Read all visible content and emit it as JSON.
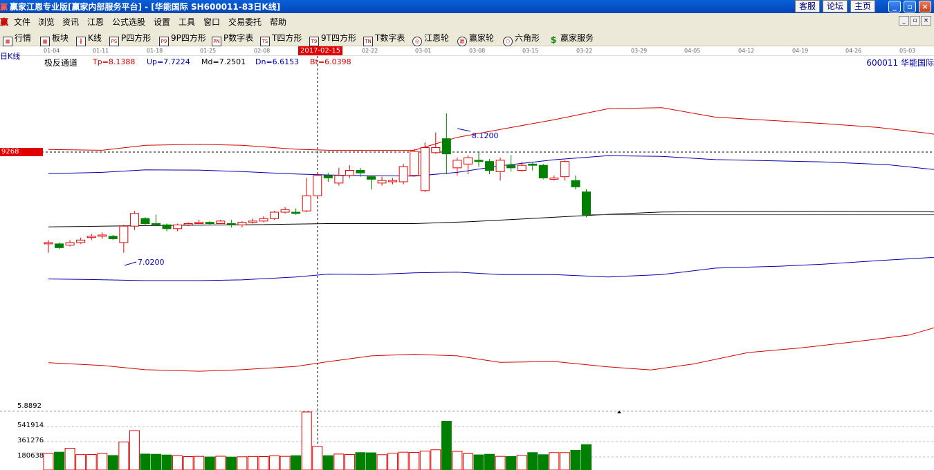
{
  "window": {
    "logo": "赢",
    "title": "赢家江恩专业版[赢家内部服务平台] - [华能国际   SH600011-83日K线]",
    "buttons": [
      "客服",
      "论坛",
      "主页"
    ],
    "controls": [
      "_",
      "▫",
      "×"
    ]
  },
  "menu": {
    "logo": "赢",
    "items": [
      "文件",
      "浏览",
      "资讯",
      "江恩",
      "公式选股",
      "设置",
      "工具",
      "窗口",
      "交易委托",
      "帮助"
    ],
    "mdi_controls": [
      "_",
      "▫",
      "×"
    ]
  },
  "toolbar": {
    "items": [
      {
        "label": "行情",
        "icon": "grid-icon",
        "glyph": "▦"
      },
      {
        "label": "板块",
        "icon": "blocks-icon",
        "glyph": "▩"
      },
      {
        "label": "K线",
        "icon": "candlestick-icon",
        "glyph": "╫"
      },
      {
        "label": "P四方形",
        "icon": "p-square-icon",
        "glyph": "PS"
      },
      {
        "label": "9P四方形",
        "icon": "9p-square-icon",
        "glyph": "P9"
      },
      {
        "label": "P数字表",
        "icon": "p-number-table-icon",
        "glyph": "PN"
      },
      {
        "label": "T四方形",
        "icon": "t-square-icon",
        "glyph": "TS"
      },
      {
        "label": "9T四方形",
        "icon": "9t-square-icon",
        "glyph": "T9"
      },
      {
        "label": "T数字表",
        "icon": "t-number-table-icon",
        "glyph": "TN"
      },
      {
        "label": "江恩轮",
        "icon": "gann-wheel-icon",
        "glyph": "◎"
      },
      {
        "label": "赢家轮",
        "icon": "winner-wheel-icon",
        "glyph": "赢"
      },
      {
        "label": "六角形",
        "icon": "hexagon-icon",
        "glyph": "⬡"
      },
      {
        "label": "赢家服务",
        "icon": "dollar-icon",
        "glyph": "$"
      }
    ]
  },
  "date_axis": {
    "labels": [
      "01-04",
      "01-11",
      "01-18",
      "01-25",
      "02-08",
      "02-22",
      "03-01",
      "03-08",
      "03-15",
      "03-22",
      "03-29",
      "04-05",
      "04-12",
      "04-19",
      "04-26",
      "05-03"
    ],
    "highlight": "2017-02-15"
  },
  "indicator": {
    "period_label": "日K线",
    "name": "极反通道",
    "tp": "Tp=8.1388",
    "up": "Up=7.7224",
    "md": "Md=7.2501",
    "dn": "Dn=6.6153",
    "bt": "Bt=6.0398",
    "stock": "600011 华能国际",
    "price_marker": "9268",
    "high_label": "8.1200",
    "low_label": "7.0200"
  },
  "volume": {
    "labels": [
      "5.8892",
      "541914",
      "361276",
      "180638"
    ]
  },
  "colors": {
    "titlebar": "#0453c4",
    "up_candle": "#e00000",
    "down_candle": "#008000",
    "tp_bt_line": "#d00000",
    "up_dn_line": "#0000b0",
    "md_line": "#000000"
  },
  "chart_data": {
    "type": "candlestick",
    "y_range": [
      5.84,
      8.48
    ],
    "candles": [
      {
        "o": 7.09,
        "c": 7.1,
        "h": 7.12,
        "l": 7.02
      },
      {
        "o": 7.09,
        "c": 7.06,
        "h": 7.1,
        "l": 7.05
      },
      {
        "o": 7.08,
        "c": 7.1,
        "h": 7.12,
        "l": 7.07
      },
      {
        "o": 7.1,
        "c": 7.12,
        "h": 7.14,
        "l": 7.09
      },
      {
        "o": 7.14,
        "c": 7.15,
        "h": 7.17,
        "l": 7.12
      },
      {
        "o": 7.15,
        "c": 7.16,
        "h": 7.18,
        "l": 7.13
      },
      {
        "o": 7.15,
        "c": 7.13,
        "h": 7.16,
        "l": 7.12
      },
      {
        "o": 7.1,
        "c": 7.23,
        "h": 7.24,
        "l": 7.02
      },
      {
        "o": 7.23,
        "c": 7.33,
        "h": 7.35,
        "l": 7.2
      },
      {
        "o": 7.29,
        "c": 7.25,
        "h": 7.3,
        "l": 7.24
      },
      {
        "o": 7.25,
        "c": 7.24,
        "h": 7.32,
        "l": 7.23
      },
      {
        "o": 7.24,
        "c": 7.21,
        "h": 7.25,
        "l": 7.19
      },
      {
        "o": 7.21,
        "c": 7.24,
        "h": 7.25,
        "l": 7.19
      },
      {
        "o": 7.24,
        "c": 7.25,
        "h": 7.26,
        "l": 7.23
      },
      {
        "o": 7.25,
        "c": 7.26,
        "h": 7.28,
        "l": 7.25
      },
      {
        "o": 7.26,
        "c": 7.25,
        "h": 7.27,
        "l": 7.24
      },
      {
        "o": 7.25,
        "c": 7.27,
        "h": 7.28,
        "l": 7.25
      },
      {
        "o": 7.25,
        "c": 7.24,
        "h": 7.28,
        "l": 7.22
      },
      {
        "o": 7.24,
        "c": 7.26,
        "h": 7.27,
        "l": 7.22
      },
      {
        "o": 7.26,
        "c": 7.27,
        "h": 7.29,
        "l": 7.25
      },
      {
        "o": 7.27,
        "c": 7.29,
        "h": 7.31,
        "l": 7.26
      },
      {
        "o": 7.29,
        "c": 7.34,
        "h": 7.35,
        "l": 7.28
      },
      {
        "o": 7.34,
        "c": 7.36,
        "h": 7.38,
        "l": 7.33
      },
      {
        "o": 7.34,
        "c": 7.33,
        "h": 7.37,
        "l": 7.32
      },
      {
        "o": 7.35,
        "c": 7.47,
        "h": 7.61,
        "l": 7.34
      },
      {
        "o": 7.47,
        "c": 7.63,
        "h": 7.65,
        "l": 7.45
      },
      {
        "o": 7.63,
        "c": 7.61,
        "h": 7.65,
        "l": 7.58
      },
      {
        "o": 7.57,
        "c": 7.63,
        "h": 7.69,
        "l": 7.55
      },
      {
        "o": 7.63,
        "c": 7.67,
        "h": 7.71,
        "l": 7.61
      },
      {
        "o": 7.67,
        "c": 7.65,
        "h": 7.69,
        "l": 7.62
      },
      {
        "o": 7.62,
        "c": 7.6,
        "h": 7.63,
        "l": 7.52
      },
      {
        "o": 7.57,
        "c": 7.59,
        "h": 7.62,
        "l": 7.55
      },
      {
        "o": 7.58,
        "c": 7.59,
        "h": 7.61,
        "l": 7.56
      },
      {
        "o": 7.58,
        "c": 7.7,
        "h": 7.72,
        "l": 7.56
      },
      {
        "o": 7.63,
        "c": 7.82,
        "h": 7.84,
        "l": 7.62
      },
      {
        "o": 7.51,
        "c": 7.85,
        "h": 7.89,
        "l": 7.5
      },
      {
        "o": 7.81,
        "c": 7.85,
        "h": 7.97,
        "l": 7.8
      },
      {
        "o": 7.92,
        "c": 7.8,
        "h": 8.12,
        "l": 7.64
      },
      {
        "o": 7.69,
        "c": 7.75,
        "h": 7.77,
        "l": 7.63
      },
      {
        "o": 7.72,
        "c": 7.77,
        "h": 7.79,
        "l": 7.64
      },
      {
        "o": 7.75,
        "c": 7.74,
        "h": 7.82,
        "l": 7.7
      },
      {
        "o": 7.74,
        "c": 7.67,
        "h": 7.76,
        "l": 7.64
      },
      {
        "o": 7.66,
        "c": 7.75,
        "h": 7.77,
        "l": 7.59
      },
      {
        "o": 7.71,
        "c": 7.69,
        "h": 7.79,
        "l": 7.66
      },
      {
        "o": 7.67,
        "c": 7.71,
        "h": 7.74,
        "l": 7.66
      },
      {
        "o": 7.72,
        "c": 7.71,
        "h": 7.73,
        "l": 7.67
      },
      {
        "o": 7.71,
        "c": 7.61,
        "h": 7.72,
        "l": 7.6
      },
      {
        "o": 7.6,
        "c": 7.61,
        "h": 7.63,
        "l": 7.59
      },
      {
        "o": 7.62,
        "c": 7.74,
        "h": 7.75,
        "l": 7.59
      },
      {
        "o": 7.59,
        "c": 7.54,
        "h": 7.63,
        "l": 7.52
      },
      {
        "o": 7.5,
        "c": 7.32,
        "h": 7.52,
        "l": 7.3
      }
    ],
    "volumes": [
      160000,
      172000,
      210000,
      149000,
      150000,
      160000,
      140000,
      270000,
      380000,
      154000,
      152000,
      145000,
      138000,
      130000,
      132000,
      126000,
      133000,
      125000,
      128000,
      131000,
      130000,
      136000,
      132000,
      138000,
      560000,
      228000,
      138000,
      154000,
      150000,
      168000,
      166000,
      148000,
      162000,
      172000,
      170000,
      182000,
      195000,
      470000,
      180000,
      158000,
      146000,
      152000,
      132000,
      130000,
      142000,
      168000,
      148000,
      168000,
      168000,
      190000,
      245000
    ],
    "volume_range": [
      0,
      600000
    ],
    "tp_line": [
      [
        0,
        7.835
      ],
      [
        5,
        7.829
      ],
      [
        9,
        7.868
      ],
      [
        14,
        7.876
      ],
      [
        18,
        7.868
      ],
      [
        23,
        7.837
      ],
      [
        26,
        7.829
      ],
      [
        30,
        7.829
      ],
      [
        34,
        7.829
      ],
      [
        38,
        7.931
      ],
      [
        42,
        7.993
      ],
      [
        47,
        8.07
      ],
      [
        52,
        8.156
      ],
      [
        57,
        8.165
      ],
      [
        62,
        8.09
      ],
      [
        72,
        8.04
      ],
      [
        77,
        8.01
      ],
      [
        82,
        7.96
      ],
      [
        88,
        7.86
      ],
      [
        93,
        7.8
      ]
    ],
    "up_line": [
      [
        0,
        7.645
      ],
      [
        5,
        7.654
      ],
      [
        9,
        7.674
      ],
      [
        14,
        7.672
      ],
      [
        18,
        7.66
      ],
      [
        23,
        7.641
      ],
      [
        26,
        7.634
      ],
      [
        30,
        7.628
      ],
      [
        34,
        7.625
      ],
      [
        38,
        7.654
      ],
      [
        42,
        7.706
      ],
      [
        47,
        7.754
      ],
      [
        52,
        7.786
      ],
      [
        57,
        7.78
      ],
      [
        62,
        7.755
      ],
      [
        72,
        7.737
      ],
      [
        78,
        7.715
      ],
      [
        82,
        7.68
      ],
      [
        88,
        7.64
      ],
      [
        93,
        7.62
      ]
    ],
    "md_line": [
      [
        0,
        7.224
      ],
      [
        9,
        7.234
      ],
      [
        18,
        7.24
      ],
      [
        26,
        7.25
      ],
      [
        34,
        7.25
      ],
      [
        39,
        7.264
      ],
      [
        45,
        7.291
      ],
      [
        52,
        7.323
      ],
      [
        57,
        7.341
      ],
      [
        62,
        7.345
      ],
      [
        72,
        7.348
      ],
      [
        80,
        7.345
      ],
      [
        88,
        7.334
      ],
      [
        93,
        7.32
      ]
    ],
    "dn_line": [
      [
        0,
        6.813
      ],
      [
        5,
        6.807
      ],
      [
        9,
        6.8
      ],
      [
        14,
        6.8
      ],
      [
        18,
        6.806
      ],
      [
        23,
        6.829
      ],
      [
        26,
        6.851
      ],
      [
        30,
        6.848
      ],
      [
        34,
        6.861
      ],
      [
        38,
        6.867
      ],
      [
        42,
        6.848
      ],
      [
        47,
        6.848
      ],
      [
        52,
        6.829
      ],
      [
        57,
        6.848
      ],
      [
        62,
        6.899
      ],
      [
        68,
        6.914
      ],
      [
        72,
        6.93
      ],
      [
        77,
        6.957
      ],
      [
        82,
        6.982
      ],
      [
        88,
        6.998
      ],
      [
        93,
        7.01
      ]
    ],
    "bt_line": [
      [
        0,
        6.152
      ],
      [
        5,
        6.13
      ],
      [
        9,
        6.097
      ],
      [
        14,
        6.085
      ],
      [
        18,
        6.097
      ],
      [
        23,
        6.123
      ],
      [
        26,
        6.16
      ],
      [
        30,
        6.206
      ],
      [
        34,
        6.219
      ],
      [
        38,
        6.206
      ],
      [
        42,
        6.155
      ],
      [
        47,
        6.162
      ],
      [
        52,
        6.12
      ],
      [
        56,
        6.095
      ],
      [
        60,
        6.143
      ],
      [
        65,
        6.232
      ],
      [
        70,
        6.27
      ],
      [
        75,
        6.318
      ],
      [
        80,
        6.37
      ],
      [
        83,
        6.445
      ],
      [
        88,
        6.53
      ],
      [
        93,
        6.585
      ]
    ]
  }
}
